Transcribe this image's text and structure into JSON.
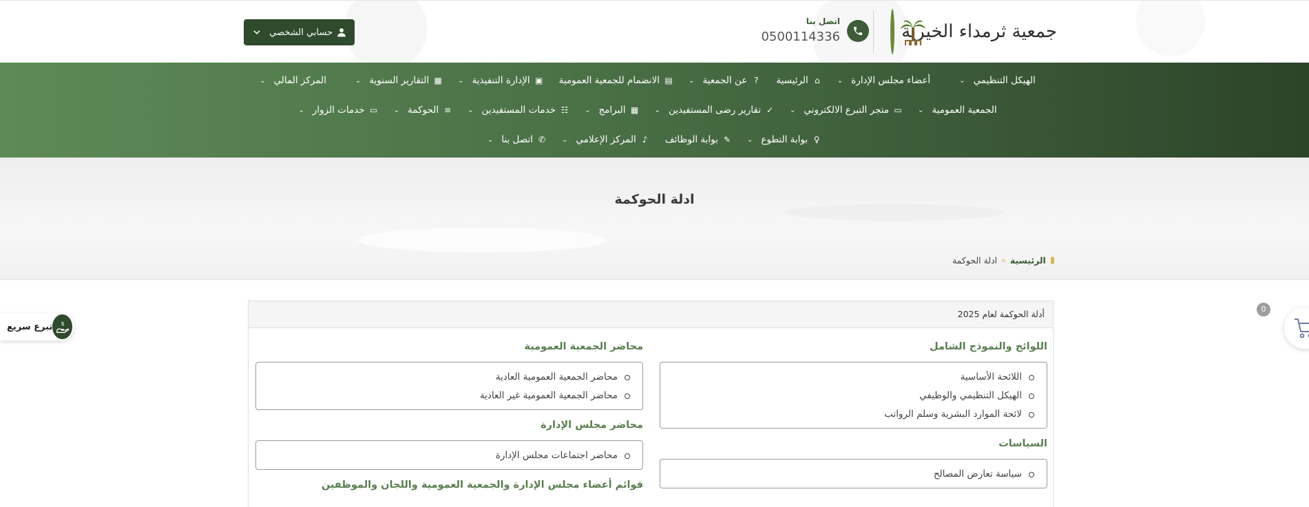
{
  "header": {
    "logo_text": "جمعية ثرمداء الخيرية",
    "contact_label": "اتصل بنا",
    "contact_phone": "0500114336",
    "account_label": "حسابي الشخصي"
  },
  "nav": {
    "row1": [
      {
        "label": "الهيكل التنظيمي",
        "icon": ""
      },
      {
        "label": "أعضاء مجلس الإدارة",
        "icon": ""
      },
      {
        "label": "الرئيسية",
        "icon": "⌂"
      },
      {
        "label": "عن الجمعية",
        "icon": "?"
      },
      {
        "label": "الانضمام للجمعية العمومية",
        "icon": "▤"
      },
      {
        "label": "الإدارة التنفيذية",
        "icon": "▣"
      },
      {
        "label": "التقارير السنوية",
        "icon": "▦"
      },
      {
        "label": "المركز المالي",
        "icon": ""
      }
    ],
    "row2": [
      {
        "label": "الجمعية العمومية",
        "icon": ""
      },
      {
        "label": "متجر التبرع الالكتروني",
        "icon": "▭"
      },
      {
        "label": "تقارير رضى المستفيدين",
        "icon": "✓"
      },
      {
        "label": "البرامج",
        "icon": "▦"
      },
      {
        "label": "خدمات المستفيدين",
        "icon": "☷"
      },
      {
        "label": "الحوكمة",
        "icon": "≡"
      },
      {
        "label": "خدمات الزوار",
        "icon": "▭"
      }
    ],
    "row3": [
      {
        "label": "بوابة التطوع",
        "icon": "♀"
      },
      {
        "label": "بوابة الوظائف",
        "icon": "✎"
      },
      {
        "label": "المركز الإعلامي",
        "icon": "♪"
      },
      {
        "label": "اتصل بنا",
        "icon": "✆"
      }
    ]
  },
  "banner": {
    "title": "ادلة الحوكمة",
    "breadcrumb_home": "الرئيسية",
    "breadcrumb_sep": "»",
    "breadcrumb_current": "ادلة الحوكمة"
  },
  "panel": {
    "heading": "أدلة الحوكمة لعام 2025",
    "right_sections": [
      {
        "title": "اللوائح والنموذج الشامل",
        "items": [
          "اللائحة الأساسية",
          "الهيكل التنظيمي والوظيفي",
          "لائحة الموارد البشرية وسلم الرواتب"
        ]
      },
      {
        "title": "السياسات",
        "items": [
          "سياسة تعارض المصالح"
        ]
      }
    ],
    "left_sections": [
      {
        "title": "محاضر الجمعية العمومية",
        "items": [
          "محاضر الجمعية العمومية العادية",
          "محاضر الجمعية العمومية غير العادية"
        ]
      },
      {
        "title": "محاضر مجلس الإدارة",
        "items": [
          "محاضر اجتماعات مجلس الإدارة"
        ]
      },
      {
        "title": "قوائم أعضاء مجلس الإدارة والجمعية العمومية واللجان والموظفين",
        "items": []
      }
    ]
  },
  "cart": {
    "count": "0"
  },
  "quick_donate": {
    "label": "تبرع سريع"
  },
  "colors": {
    "primary": "#2f4a2c",
    "accent": "#5a7f50",
    "gold": "#d9b64a"
  }
}
